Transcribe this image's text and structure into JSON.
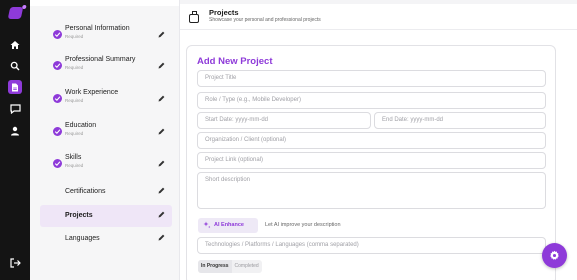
{
  "header": {
    "title": "Projects",
    "subtitle": "Showcase your personal and professional projects"
  },
  "steps": [
    {
      "label": "Personal Information",
      "status": "Required",
      "done": true
    },
    {
      "label": "Professional Summary",
      "status": "Required",
      "done": true
    },
    {
      "label": "Work Experience",
      "status": "Required",
      "done": true
    },
    {
      "label": "Education",
      "status": "Required",
      "done": true
    },
    {
      "label": "Skills",
      "status": "Required",
      "done": true
    },
    {
      "label": "Certifications",
      "done": false
    },
    {
      "label": "Projects",
      "done": false,
      "active": true
    },
    {
      "label": "Languages",
      "done": false
    }
  ],
  "form": {
    "title": "Add New Project",
    "placeholders": {
      "project_title": "Project Title",
      "role": "Role / Type (e.g., Mobile Developer)",
      "start_date": "Start Date: yyyy-mm-dd",
      "end_date": "End Date: yyyy-mm-dd",
      "organization": "Organization / Client (optional)",
      "link": "Project Link (optional)",
      "description": "Short description",
      "technologies": "Technologies / Platforms / Languages (comma separated)"
    },
    "ai_button": "AI Enhance",
    "ai_hint": "Let AI improve your description",
    "status_options": [
      "In Progress",
      "Completed"
    ],
    "status_selected": "In Progress"
  },
  "icons": {
    "rail": [
      "logo-icon",
      "home-icon",
      "search-icon",
      "document-icon",
      "chat-icon",
      "user-icon",
      "logout-icon"
    ],
    "fab": "gear-icon"
  },
  "colors": {
    "accent": "#8e3ad9",
    "rail_bg": "#141414"
  }
}
